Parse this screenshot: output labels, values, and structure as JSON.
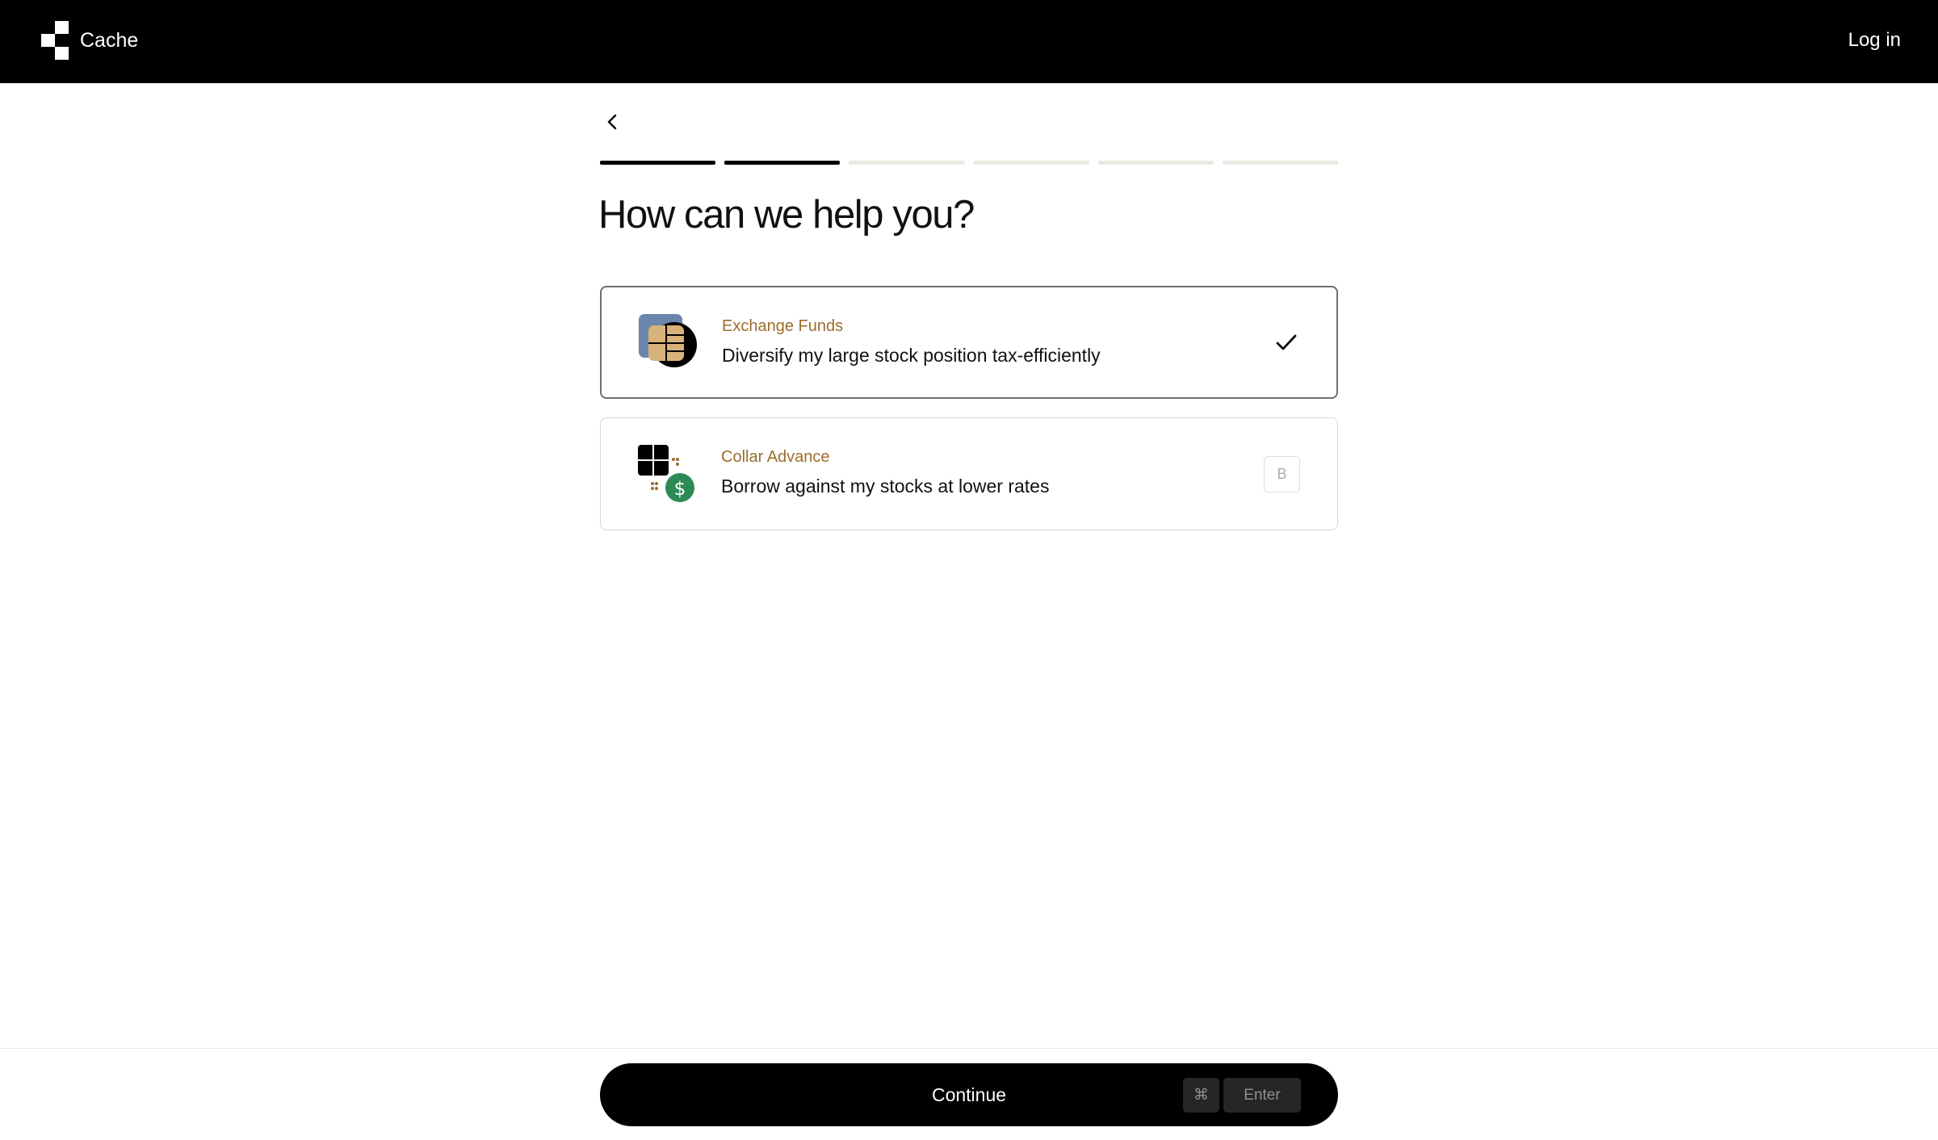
{
  "header": {
    "brand_name": "Cache",
    "login_label": "Log in"
  },
  "progress": {
    "total_steps": 6,
    "completed_steps": 2
  },
  "main": {
    "title": "How can we help you?"
  },
  "options": [
    {
      "name": "Exchange Funds",
      "description": "Diversify my large stock position tax-efficiently",
      "selected": true,
      "icon": "exchange-funds-icon"
    },
    {
      "name": "Collar Advance",
      "description": "Borrow against my stocks at lower rates",
      "selected": false,
      "shortcut_key": "B",
      "icon": "collar-advance-icon"
    }
  ],
  "footer": {
    "continue_label": "Continue",
    "shortcut_modifier": "⌘",
    "shortcut_key": "Enter"
  },
  "colors": {
    "accent_gold": "#9a6d2a",
    "icon_blue": "#6c85ad",
    "icon_tan": "#d7b27a",
    "dollar_green": "#2e8a55"
  }
}
